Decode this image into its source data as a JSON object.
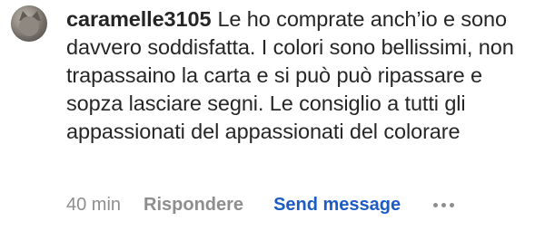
{
  "comment": {
    "username": "caramelle3105",
    "text": "Le ho comprate anch’io e sono davvero soddisfatta. I colori sono bellissimi, non trapassaino la carta e si può può ripassare e sopza lasciare segni. Le consiglio a tutti gli appassionati del appassionati del colorare",
    "timestamp": "40 min",
    "reply_label": "Rispondere",
    "send_message_label": "Send message",
    "more_icon": "more-horizontal-icon",
    "avatar_icon": "user-avatar"
  },
  "colors": {
    "text": "#262626",
    "muted": "#8e8e8e",
    "link": "#1c5cc4",
    "background": "#ffffff"
  }
}
